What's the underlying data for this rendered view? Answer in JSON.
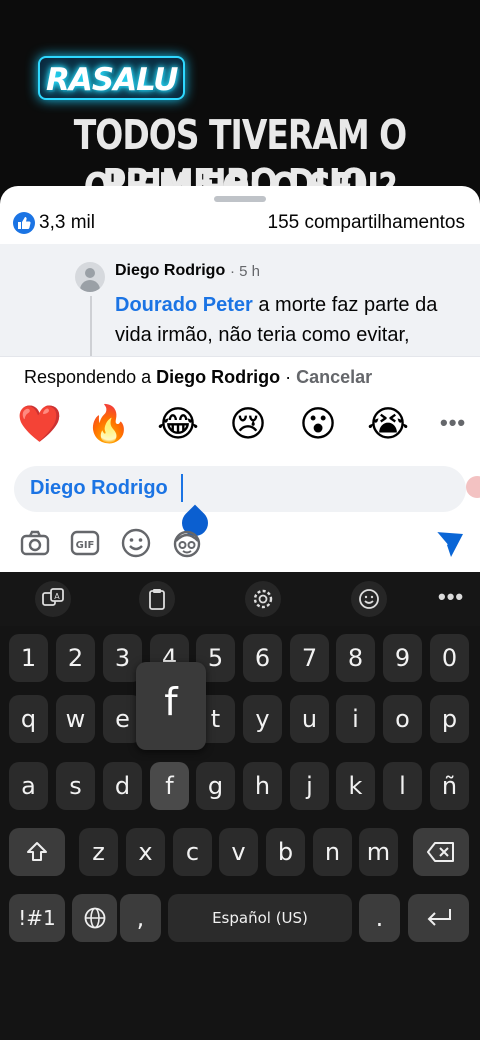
{
  "overlay": {
    "logo": "RASALU",
    "caption_line1": "TODOS TIVERAM O PRIMEIRO DUO,",
    "caption_line2": "QUEM FOI O SEU?"
  },
  "stats": {
    "likes": "3,3 mil",
    "shares": "155 compartilhamentos"
  },
  "comment": {
    "author": "Diego Rodrigo",
    "time": "· 5 h",
    "mention": "Dourado Peter",
    "text": " a morte faz parte da vida irmão, não teria como evitar, mesmo que ele tivesse vivido"
  },
  "reply_bar": {
    "prefix": "Respondendo a ",
    "name": "Diego Rodrigo",
    "separator": " · ",
    "cancel": "Cancelar"
  },
  "reactions": [
    "❤️",
    "🔥",
    "😂",
    "😢",
    "😮",
    "😭"
  ],
  "reactions_more": "•••",
  "input": {
    "value": "Diego Rodrigo"
  },
  "tools": [
    "camera-icon",
    "gif-icon",
    "emoji-icon",
    "avatar-sticker-icon",
    "send-icon"
  ],
  "keyboard": {
    "toolbar": [
      "translate-icon",
      "clipboard-icon",
      "settings-icon",
      "emoji-icon"
    ],
    "more": "•••",
    "popup": "f",
    "row_numbers": [
      "1",
      "2",
      "3",
      "4",
      "5",
      "6",
      "7",
      "8",
      "9",
      "0"
    ],
    "row1": [
      "q",
      "w",
      "e",
      "r",
      "t",
      "y",
      "u",
      "i",
      "o",
      "p"
    ],
    "row2": [
      "a",
      "s",
      "d",
      "f",
      "g",
      "h",
      "j",
      "k",
      "l",
      "ñ"
    ],
    "row3": [
      "z",
      "x",
      "c",
      "v",
      "b",
      "n",
      "m"
    ],
    "symbols": "!#1",
    "comma": ",",
    "space": "Español (US)",
    "period": "."
  },
  "colors": {
    "accent": "#1b74e4",
    "keyboard_bg": "#141414",
    "key_bg": "#2b2b2b"
  }
}
